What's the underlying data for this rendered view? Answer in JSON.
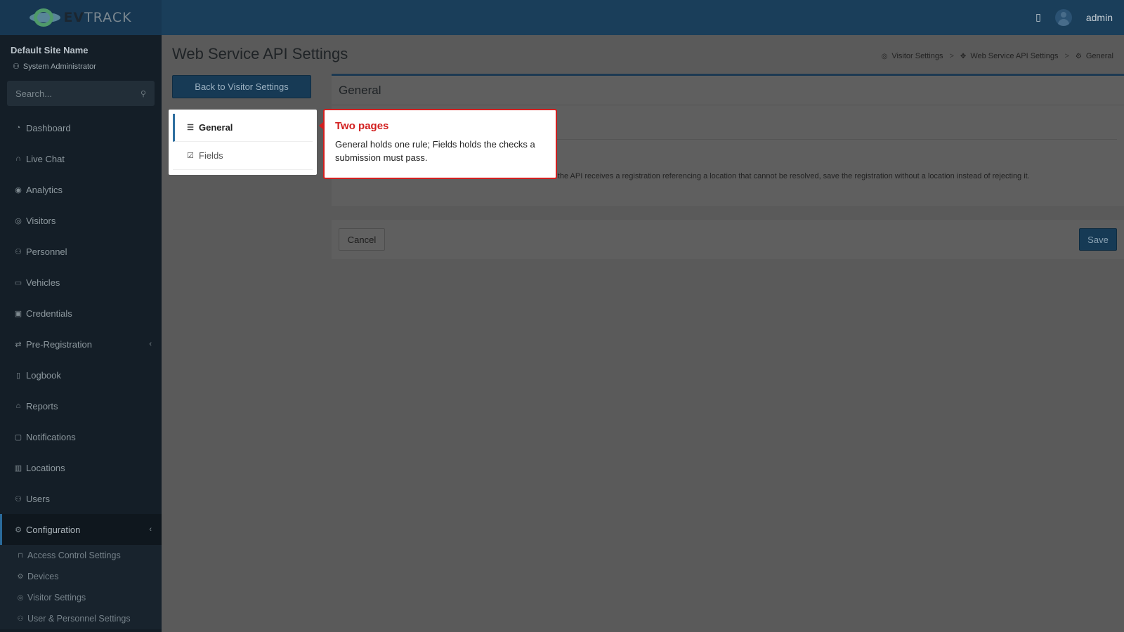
{
  "header": {
    "brand_prefix": "EV",
    "brand_suffix": "TRACK",
    "user": "admin"
  },
  "sidebar": {
    "site_name": "Default Site Name",
    "role": "System Administrator",
    "search_placeholder": "Search...",
    "items": [
      {
        "label": "Dashboard",
        "icon": "dashboard-icon"
      },
      {
        "label": "Live Chat",
        "icon": "headset-icon"
      },
      {
        "label": "Analytics",
        "icon": "analytics-icon"
      },
      {
        "label": "Visitors",
        "icon": "eye-icon"
      },
      {
        "label": "Personnel",
        "icon": "personnel-icon"
      },
      {
        "label": "Vehicles",
        "icon": "car-icon"
      },
      {
        "label": "Credentials",
        "icon": "badge-icon"
      },
      {
        "label": "Pre-Registration",
        "icon": "swap-icon"
      },
      {
        "label": "Logbook",
        "icon": "book-icon"
      },
      {
        "label": "Reports",
        "icon": "chart-icon"
      },
      {
        "label": "Notifications",
        "icon": "bell-icon"
      },
      {
        "label": "Locations",
        "icon": "map-icon"
      },
      {
        "label": "Users",
        "icon": "users-icon"
      },
      {
        "label": "Configuration",
        "icon": "gear-icon"
      }
    ],
    "sub_items": [
      {
        "label": "Access Control Settings",
        "icon": "lock-icon"
      },
      {
        "label": "Devices",
        "icon": "device-icon"
      },
      {
        "label": "Visitor Settings",
        "icon": "eye-icon"
      },
      {
        "label": "User & Personnel Settings",
        "icon": "user-settings-icon"
      }
    ]
  },
  "main": {
    "title": "Web Service API Settings",
    "breadcrumb": [
      "Visitor Settings",
      "Web Service API Settings",
      "General"
    ],
    "back_button": "Back to Visitor Settings",
    "side_nav": [
      {
        "label": "General",
        "icon": "sliders-icon"
      },
      {
        "label": "Fields",
        "icon": "checklist-icon"
      }
    ],
    "panel_title": "General",
    "rule_description": "When the API receives a registration referencing a location that cannot be resolved, save the registration without a location instead of rejecting it.",
    "cancel": "Cancel",
    "save": "Save"
  },
  "callout": {
    "title": "Two pages",
    "body": "General holds one rule; Fields holds the checks a submission must pass.",
    "border_color": "#d21e1e"
  }
}
